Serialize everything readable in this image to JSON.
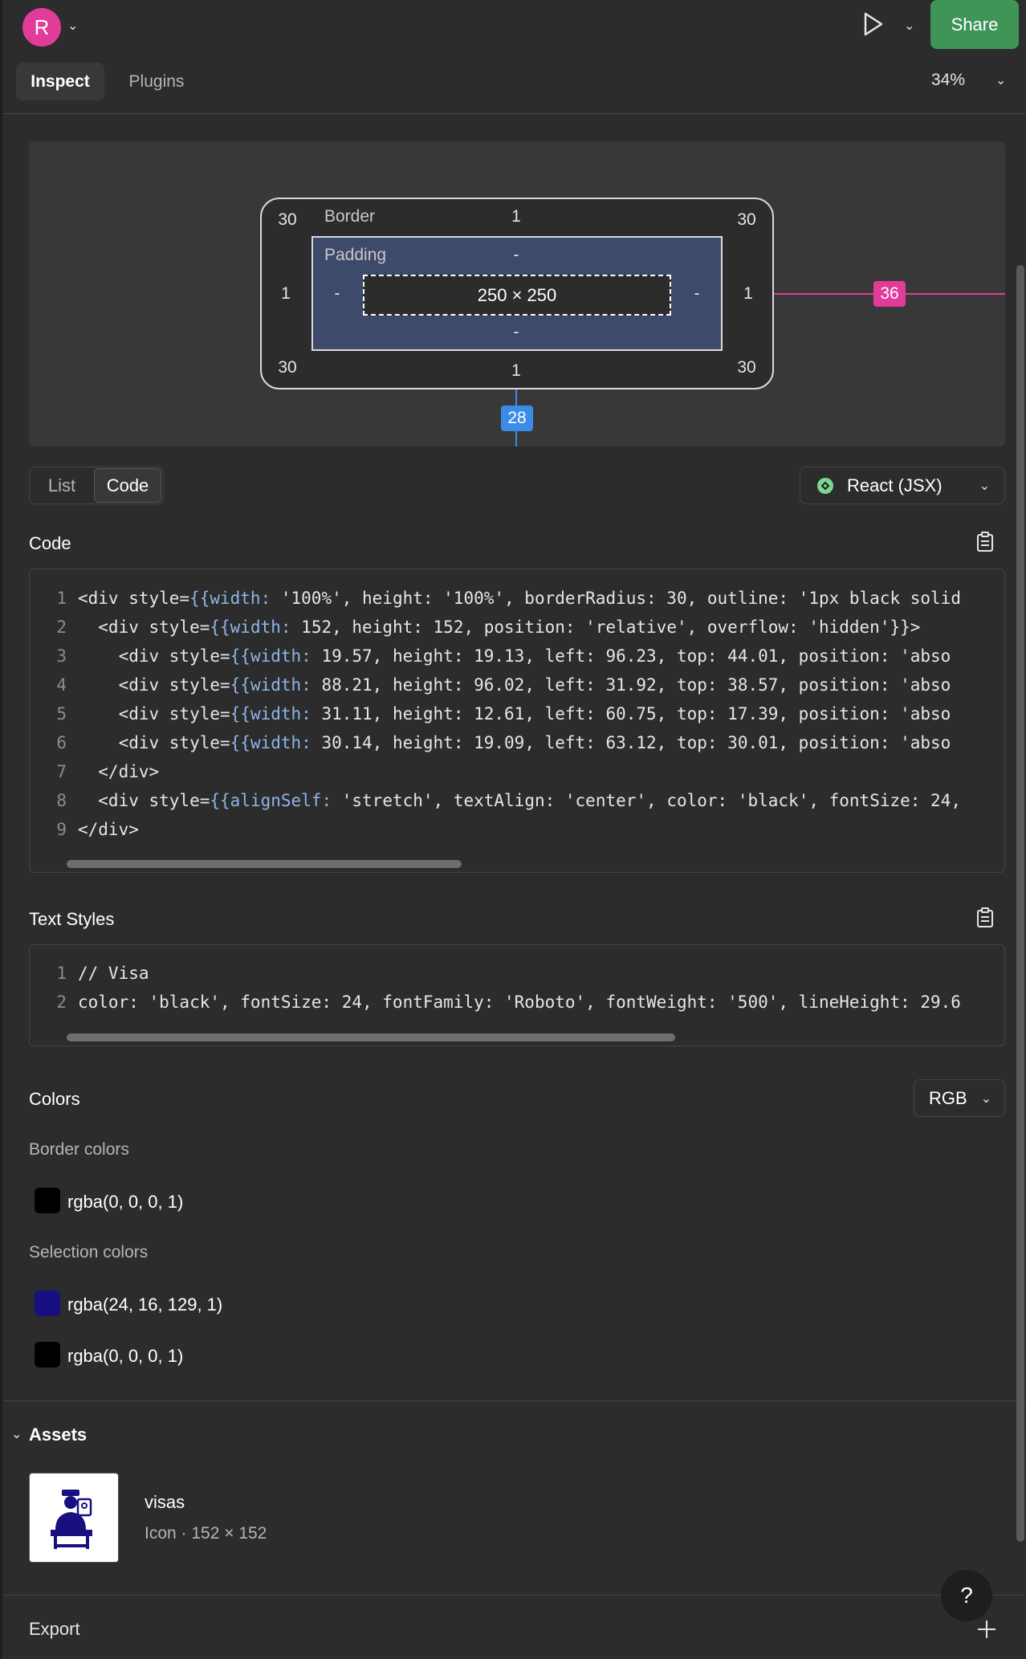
{
  "header": {
    "avatar_letter": "R",
    "share_label": "Share",
    "zoom": "34%",
    "tabs": [
      {
        "label": "Inspect",
        "active": true
      },
      {
        "label": "Plugins",
        "active": false
      }
    ]
  },
  "box_model": {
    "border_label": "Border",
    "padding_label": "Padding",
    "radius_tl": "30",
    "radius_tr": "30",
    "radius_bl": "30",
    "radius_br": "30",
    "border_top": "1",
    "border_bottom": "1",
    "border_left": "1",
    "border_right": "1",
    "padding_top": "-",
    "padding_bottom": "-",
    "padding_left": "-",
    "padding_right": "-",
    "content_size": "250 × 250",
    "spacing_right": "36",
    "spacing_bottom": "28"
  },
  "view_toggle": {
    "list_label": "List",
    "code_label": "Code",
    "active": "Code"
  },
  "language_dropdown": {
    "label": "React (JSX)"
  },
  "code_section": {
    "title": "Code",
    "lines": [
      {
        "n": "1",
        "a": "<div style=",
        "b": "{{width: ",
        "c": "'100%', height: '100%', borderRadius: 30, outline: '1px black solid"
      },
      {
        "n": "2",
        "a": "  <div style=",
        "b": "{{width: ",
        "c": "152, height: 152, position: 'relative', overflow: 'hidden'}}>"
      },
      {
        "n": "3",
        "a": "    <div style=",
        "b": "{{width: ",
        "c": "19.57, height: 19.13, left: 96.23, top: 44.01, position: 'abso"
      },
      {
        "n": "4",
        "a": "    <div style=",
        "b": "{{width: ",
        "c": "88.21, height: 96.02, left: 31.92, top: 38.57, position: 'abso"
      },
      {
        "n": "5",
        "a": "    <div style=",
        "b": "{{width: ",
        "c": "31.11, height: 12.61, left: 60.75, top: 17.39, position: 'abso"
      },
      {
        "n": "6",
        "a": "    <div style=",
        "b": "{{width: ",
        "c": "30.14, height: 19.09, left: 63.12, top: 30.01, position: 'abso"
      },
      {
        "n": "7",
        "a": "  </div>",
        "b": "",
        "c": ""
      },
      {
        "n": "8",
        "a": "  <div style=",
        "b": "{{alignSelf: ",
        "c": "'stretch', textAlign: 'center', color: 'black', fontSize: 24,"
      },
      {
        "n": "9",
        "a": "</div>",
        "b": "",
        "c": ""
      }
    ]
  },
  "text_styles": {
    "title": "Text Styles",
    "lines": [
      {
        "n": "1",
        "text": "// Visa"
      },
      {
        "n": "2",
        "text": "color: 'black', fontSize: 24, fontFamily: 'Roboto', fontWeight: '500', lineHeight: 29.6"
      }
    ]
  },
  "colors": {
    "title": "Colors",
    "format": "RGB",
    "border_title": "Border colors",
    "border_colors": [
      {
        "label": "rgba(0, 0, 0, 1)",
        "hex": "#000000"
      }
    ],
    "selection_title": "Selection colors",
    "selection_colors": [
      {
        "label": "rgba(24, 16, 129, 1)",
        "hex": "#181081"
      },
      {
        "label": "rgba(0, 0, 0, 1)",
        "hex": "#000000"
      }
    ]
  },
  "assets": {
    "title": "Assets",
    "name": "visas",
    "meta": "Icon · 152 × 152"
  },
  "export": {
    "title": "Export"
  },
  "help_label": "?",
  "accent_colors": {
    "share_green": "#3f9557",
    "avatar_pink": "#e23c9b",
    "spacing_blue": "#3b8ce8"
  }
}
